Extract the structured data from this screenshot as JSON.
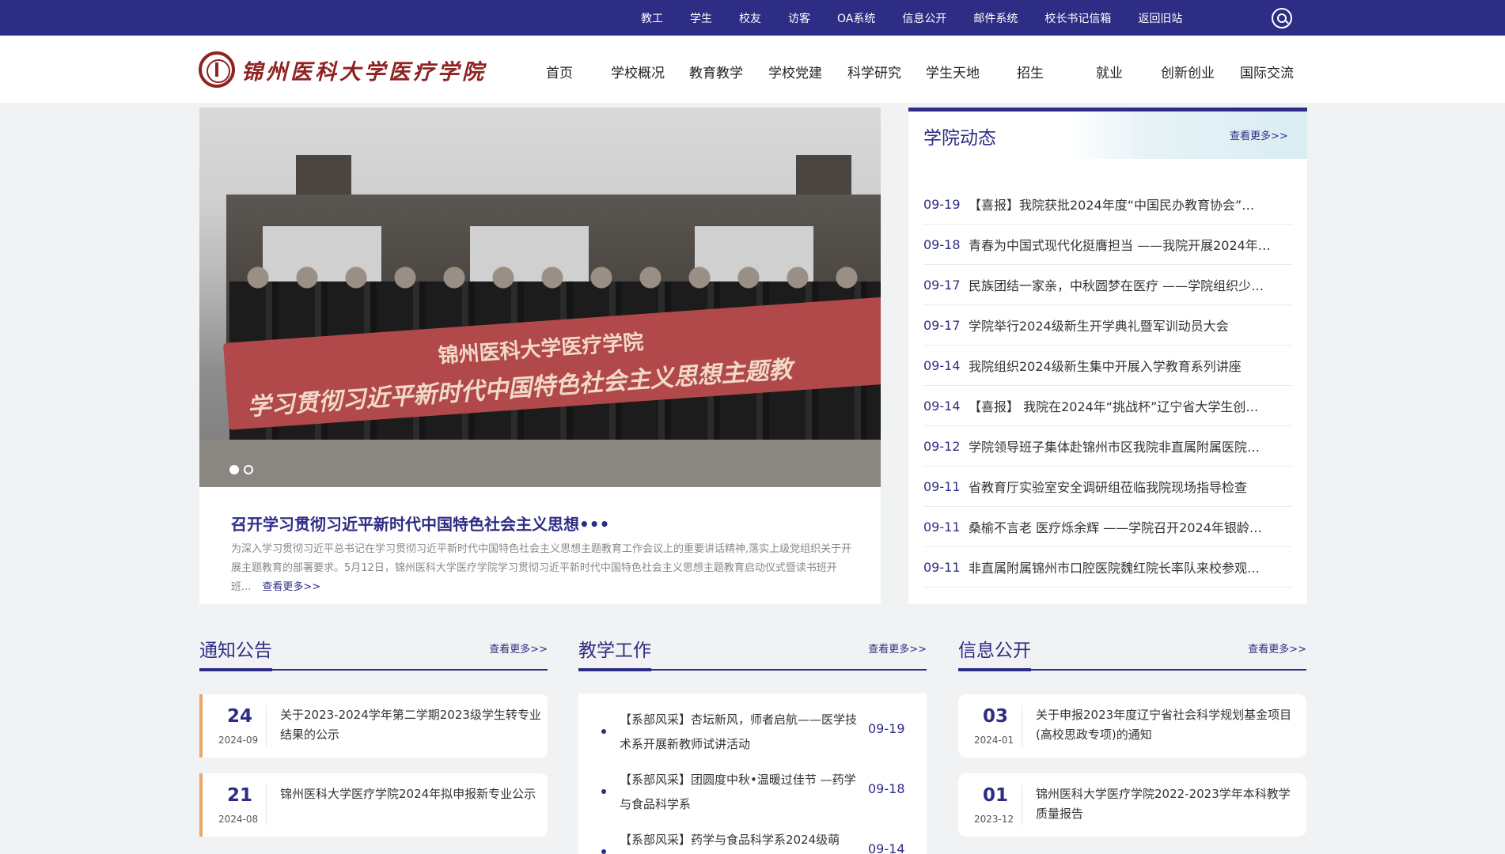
{
  "topbar": {
    "links": [
      "教工",
      "学生",
      "校友",
      "访客",
      "OA系统",
      "信息公开",
      "邮件系统",
      "校长书记信箱",
      "返回旧站"
    ],
    "search_icon": "search-icon"
  },
  "header": {
    "logo_text": "锦州医科大学医疗学院",
    "nav": [
      "首页",
      "学校概况",
      "教育教学",
      "学校党建",
      "科学研究",
      "学生天地",
      "招生",
      "就业",
      "创新创业",
      "国际交流"
    ]
  },
  "banner": {
    "flag_line1": "锦州医科大学医疗学院",
    "flag_line2": "学习贯彻习近平新时代中国特色社会主义思想主题教",
    "title": "召开学习贯彻习近平新时代中国特色社会主义思想•••",
    "desc": "为深入学习贯彻习近平总书记在学习贯彻习近平新时代中国特色社会主义思想主题教育工作会议上的重要讲话精神,落实上级党组织关于开展主题教育的部署要求。5月12日，锦州医科大学医疗学院学习贯彻习近平新时代中国特色社会主义思想主题教育启动仪式暨读书班开班...",
    "more": "查看更多>>",
    "slides_count": 2,
    "active_slide": 1
  },
  "news": {
    "title": "学院动态",
    "more": "查看更多>>",
    "items": [
      {
        "date": "09-19",
        "text": "【喜报】我院获批2024年度“中国民办教育协会”…"
      },
      {
        "date": "09-18",
        "text": "青春为中国式现代化挺膺担当 ——我院开展2024年…"
      },
      {
        "date": "09-17",
        "text": "民族团结一家亲，中秋圆梦在医疗 ——学院组织少…"
      },
      {
        "date": "09-17",
        "text": "学院举行2024级新生开学典礼暨军训动员大会"
      },
      {
        "date": "09-14",
        "text": "我院组织2024级新生集中开展入学教育系列讲座"
      },
      {
        "date": "09-14",
        "text": "【喜报】 我院在2024年“挑战杯”辽宁省大学生创…"
      },
      {
        "date": "09-12",
        "text": "学院领导班子集体赴锦州市区我院非直属附属医院…"
      },
      {
        "date": "09-11",
        "text": "省教育厅实验室安全调研组莅临我院现场指导检查"
      },
      {
        "date": "09-11",
        "text": "桑榆不言老 医疗烁余辉 ——学院召开2024年银龄…"
      },
      {
        "date": "09-11",
        "text": "非直属附属锦州市口腔医院魏红院长率队来校参观…"
      }
    ]
  },
  "notices": {
    "title": "通知公告",
    "more": "查看更多>>",
    "items": [
      {
        "day": "24",
        "ym": "2024-09",
        "text": "关于2023-2024学年第二学期2023级学生转专业结果的公示"
      },
      {
        "day": "21",
        "ym": "2024-08",
        "text": "锦州医科大学医疗学院2024年拟申报新专业公示"
      }
    ]
  },
  "teaching": {
    "title": "教学工作",
    "more": "查看更多>>",
    "items": [
      {
        "text": "【系部风采】杏坛新风，师者启航——医学技术系开展新教师试讲活动",
        "date": "09-19"
      },
      {
        "text": "【系部风采】团圆度中秋•温暖过佳节 —药学与食品科学系",
        "date": "09-18"
      },
      {
        "text": "【系部风采】药学与食品科学系2024级萌",
        "date": "09-14"
      }
    ]
  },
  "disclosure": {
    "title": "信息公开",
    "more": "查看更多>>",
    "items": [
      {
        "day": "03",
        "ym": "2024-01",
        "text": "关于申报2023年度辽宁省社会科学规划基金项目(高校思政专项)的通知"
      },
      {
        "day": "01",
        "ym": "2023-12",
        "text": "锦州医科大学医疗学院2022-2023学年本科教学质量报告"
      }
    ]
  },
  "colors": {
    "primary": "#2e2d86",
    "logo_red": "#8f2322",
    "accent_orange": "#e6a96a",
    "page_bg": "#f1f2f3"
  }
}
